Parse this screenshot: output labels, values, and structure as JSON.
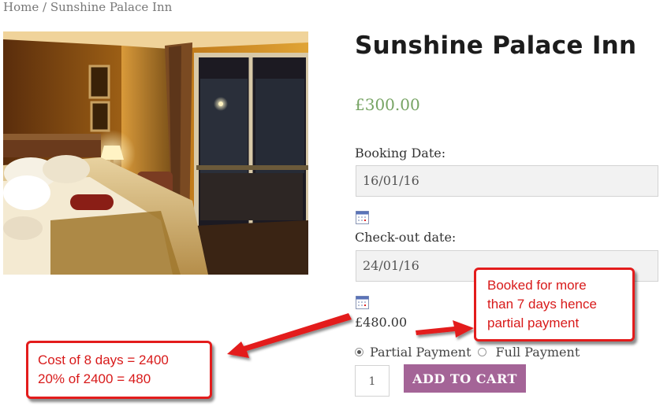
{
  "breadcrumb": {
    "home": "Home",
    "separator": " / ",
    "current": "Sunshine Palace Inn"
  },
  "product": {
    "title": "Sunshine Palace Inn",
    "price": "£300.00",
    "image_alt": "hotel-room-photo"
  },
  "booking": {
    "booking_date_label": "Booking Date:",
    "booking_date_value": "16/01/16",
    "checkout_label": "Check-out date:",
    "checkout_value": "24/01/16",
    "calendar_icon": "calendar-icon",
    "computed_cost": "£480.00"
  },
  "payment": {
    "partial_label": "Partial Payment",
    "full_label": "Full Payment",
    "selected": "partial"
  },
  "cart": {
    "quantity": "1",
    "button_label": "ADD TO CART"
  },
  "annotations": {
    "right_callout": [
      "Booked for more",
      "than 7 days hence",
      "partial payment"
    ],
    "left_callout": [
      "Cost of 8 days = 2400",
      "20% of 2400 = 480"
    ]
  },
  "colors": {
    "price_green": "#77a464",
    "button_purple": "#a46497",
    "annotation_red": "#e31c1c"
  }
}
